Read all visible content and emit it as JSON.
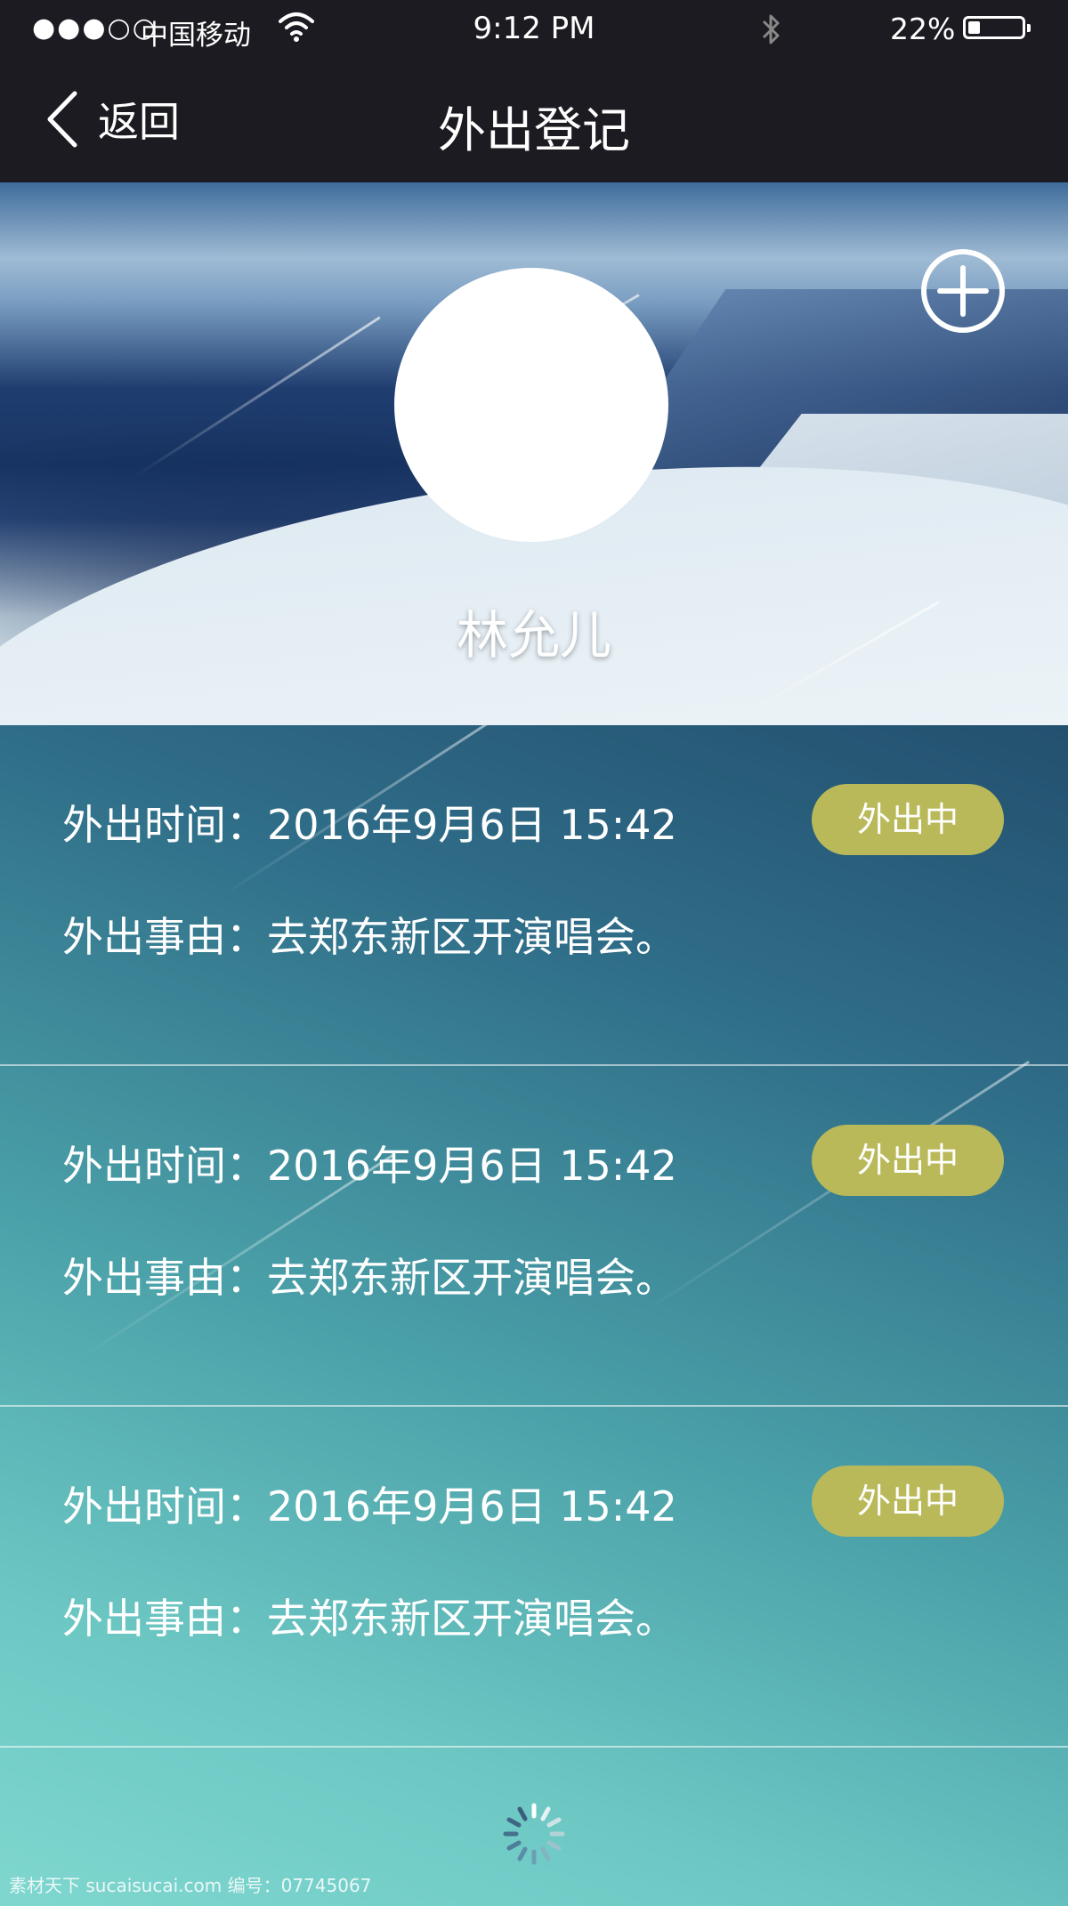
{
  "status_bar": {
    "signal": "●●●○○",
    "carrier": "中国移动",
    "time": "9:12 PM",
    "battery_percent": "22%",
    "battery_level": 0.22
  },
  "nav": {
    "back_label": "返回",
    "title": "外出登记"
  },
  "profile": {
    "name": "林允儿"
  },
  "records": [
    {
      "time": "外出时间：2016年9月6日 15:42",
      "reason": "外出事由：去郑东新区开演唱会。",
      "status": "外出中"
    },
    {
      "time": "外出时间：2016年9月6日 15:42",
      "reason": "外出事由：去郑东新区开演唱会。",
      "status": "外出中"
    },
    {
      "time": "外出时间：2016年9月6日 15:42",
      "reason": "外出事由：去郑东新区开演唱会。",
      "status": "外出中"
    }
  ],
  "colors": {
    "nav_background": "#1b1b21",
    "badge": "#b9b95a",
    "list_top": "#23506f",
    "list_bottom": "#7fd7cf"
  },
  "icons": [
    "back-chevron-icon",
    "wifi-icon",
    "bluetooth-icon",
    "battery-icon",
    "add-circle-icon",
    "loading-spinner-icon"
  ],
  "watermark": "素材天下 sucaisucai.com 编号：07745067"
}
